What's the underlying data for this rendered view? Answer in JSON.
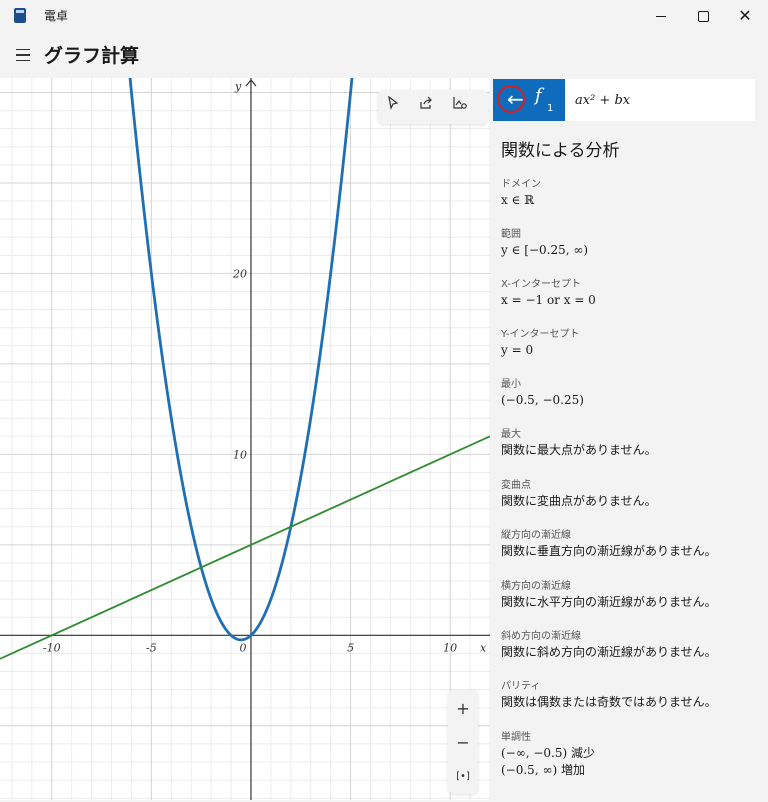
{
  "app": {
    "title": "電卓",
    "page_title": "グラフ計算",
    "icons": [
      "calculator-icon",
      "hamburger-menu-icon",
      "minimize-icon",
      "maximize-icon",
      "close-icon"
    ]
  },
  "graph": {
    "x_axis_label": "x",
    "y_axis_label": "y",
    "x_ticks": [
      "-10",
      "-5",
      "0",
      "5",
      "10"
    ],
    "y_ticks": [
      "10",
      "20"
    ],
    "x_tick_values": [
      -10,
      -5,
      0,
      5,
      10
    ],
    "y_tick_values": [
      10,
      20
    ],
    "x_range": [
      -12.6,
      12.0
    ],
    "y_range": [
      -9.1,
      30.8
    ],
    "curves": [
      {
        "function": "ax^2 + bx",
        "a": 1,
        "b": 1,
        "color": "#1f6fb5"
      },
      {
        "function": "0.5x + 5",
        "color": "#2e8b2e"
      }
    ],
    "toolbar_icons": [
      "trace-cursor-icon",
      "share-icon",
      "graph-settings-icon"
    ],
    "zoom": {
      "in_label": "+",
      "out_label": "−",
      "fit_label": "[•]"
    }
  },
  "panel": {
    "func_name": "f",
    "func_subscript": "1",
    "func_expression": "ax² + bx",
    "back_icon": "back-arrow-icon",
    "analysis_title": "関数による分析",
    "sections": [
      {
        "label": "ドメイン",
        "value": "x ∈ ℝ"
      },
      {
        "label": "範囲",
        "value": "y ∈ [−0.25, ∞)"
      },
      {
        "label": "X-インターセプト",
        "value": "x = −1 or x = 0"
      },
      {
        "label": "Y-インターセプト",
        "value": "y = 0"
      },
      {
        "label": "最小",
        "value": "(−0.5, −0.25)"
      },
      {
        "label": "最大",
        "value": "関数に最大点がありません。"
      },
      {
        "label": "変曲点",
        "value": "関数に変曲点がありません。"
      },
      {
        "label": "縦方向の漸近線",
        "value": "関数に垂直方向の漸近線がありません。"
      },
      {
        "label": "横方向の漸近線",
        "value": "関数に水平方向の漸近線がありません。"
      },
      {
        "label": "斜め方向の漸近線",
        "value": "関数に斜め方向の漸近線がありません。"
      },
      {
        "label": "パリティ",
        "value": "関数は偶数または奇数ではありません。"
      },
      {
        "label": "単調性",
        "value": "(−∞, −0.5) 減少",
        "value2": "(−0.5, ∞) 増加"
      }
    ]
  }
}
